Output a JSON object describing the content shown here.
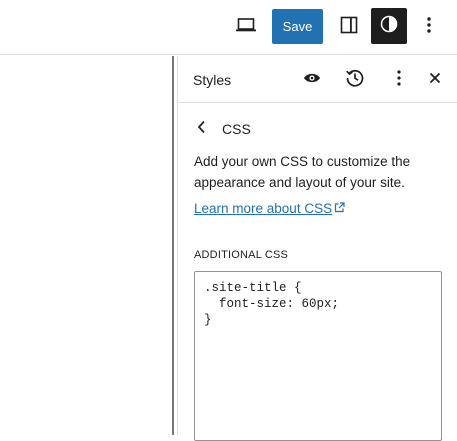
{
  "topbar": {
    "preview_icon": "laptop-icon",
    "save_label": "Save",
    "settings_icon": "sidebar-panel-icon",
    "styles_icon": "half-circle-contrast-icon",
    "options_icon": "more-vertical-icon"
  },
  "sidebar": {
    "title": "Styles",
    "header_icons": [
      "eye-icon",
      "revisions-clock-icon",
      "more-vertical-icon",
      "close-icon"
    ],
    "nav": {
      "back_icon": "chevron-left-icon",
      "title": "CSS"
    },
    "description": "Add your own CSS to customize the appearance and layout of your site.",
    "learn_more": "Learn more about CSS",
    "external_icon": "external-link-icon",
    "section_label": "ADDITIONAL CSS",
    "css_value": ".site-title {\n  font-size: 60px;\n}"
  },
  "colors": {
    "accent": "#2271b1",
    "dark": "#1e1e1e",
    "border": "#e0e0e0"
  }
}
